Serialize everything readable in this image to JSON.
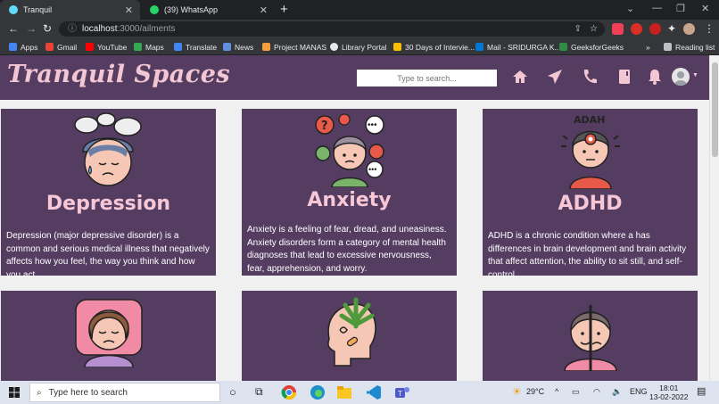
{
  "browser": {
    "tabs": [
      {
        "title": "Tranquil",
        "active": true
      },
      {
        "title": "(39) WhatsApp",
        "active": false
      }
    ],
    "address": {
      "host": "localhost",
      "path": ":3000/ailments"
    },
    "bookmarks": [
      {
        "label": "Apps",
        "color": "#4285f4"
      },
      {
        "label": "Gmail",
        "color": "#ea4335"
      },
      {
        "label": "YouTube",
        "color": "#ff0000"
      },
      {
        "label": "Maps",
        "color": "#34a853"
      },
      {
        "label": "Translate",
        "color": "#4285f4"
      },
      {
        "label": "News",
        "color": "#5f8fdf"
      },
      {
        "label": "Project MANAS",
        "color": "#f4a03a"
      },
      {
        "label": "Library Portal",
        "color": "#e8eaed"
      },
      {
        "label": "30 Days of Intervie...",
        "color": "#fbbc04"
      },
      {
        "label": "Mail - SRIDURGA K...",
        "color": "#0078d4"
      },
      {
        "label": "GeeksforGeeks",
        "color": "#2f8d46"
      }
    ],
    "reading_list": "Reading list"
  },
  "site": {
    "logo": "Tranquil Spaces",
    "search_placeholder": "Type to search...",
    "accent": "#553d62",
    "title_color": "#f7c7d6",
    "nav_icons": [
      "home-icon",
      "paper-plane-icon",
      "phone-icon",
      "book-icon",
      "bell-icon",
      "user-avatar"
    ]
  },
  "ailments": [
    {
      "title": "Depression",
      "icon": "depression-illustration",
      "description": "Depression (major depressive disorder) is a common and serious medical illness that negatively affects how you feel, the way you think and how you act."
    },
    {
      "title": "Anxiety",
      "icon": "anxiety-illustration",
      "description": "Anxiety is a feeling of fear, dread, and uneasiness. Anxiety disorders form a category of mental health diagnoses that lead to excessive nervousness, fear, apprehension, and worry."
    },
    {
      "title": "ADHD",
      "icon": "adhd-illustration",
      "description": "ADHD is a chronic condition where a has differences in brain development and brain activity that affect attention, the ability to sit still, and self-control."
    },
    {
      "title": "",
      "icon": "insomnia-illustration",
      "description": ""
    },
    {
      "title": "",
      "icon": "substance-abuse-illustration",
      "description": ""
    },
    {
      "title": "",
      "icon": "bipolar-illustration",
      "description": ""
    }
  ],
  "taskbar": {
    "search_placeholder": "Type here to search",
    "temperature": "29°C",
    "language": "ENG",
    "time": "18:01",
    "date": "13-02-2022"
  }
}
